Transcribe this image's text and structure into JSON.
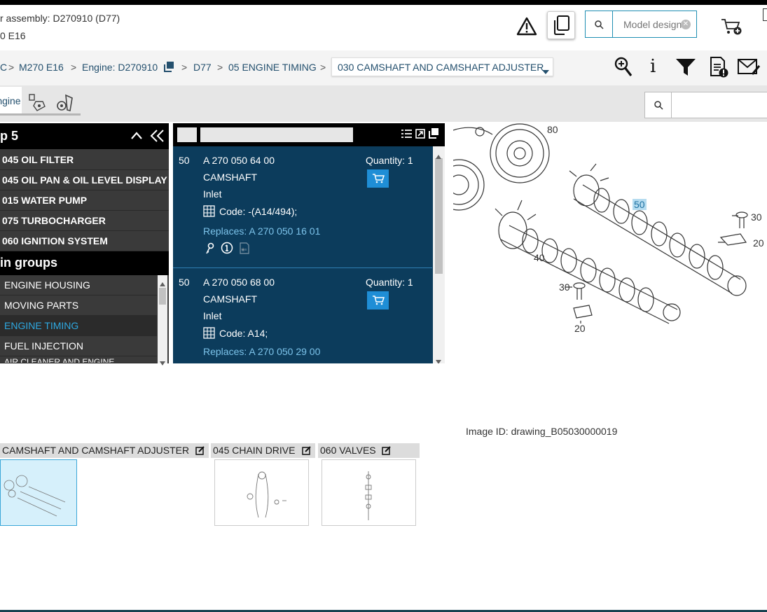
{
  "header": {
    "line1": "r assembly: D270910 (D77)",
    "line2": "0 E16",
    "search_placeholder": "Model design"
  },
  "breadcrumb": {
    "items": [
      "C",
      "M270 E16",
      "Engine: D270910",
      "D77",
      "05 ENGINE TIMING"
    ],
    "dropdown": "030 CAMSHAFT AND CAMSHAFT ADJUSTER",
    "separator": ">"
  },
  "tabs": {
    "engine_label": "Engine"
  },
  "left_panel": {
    "head1": "p 5",
    "subgroups": [
      "045 OIL FILTER",
      "045 OIL PAN & OIL LEVEL DISPLAY",
      "015 WATER PUMP",
      "075 TURBOCHARGER",
      "060 IGNITION SYSTEM"
    ],
    "head2": "in groups",
    "groups": [
      "ENGINE HOUSING",
      "MOVING PARTS",
      "ENGINE TIMING",
      "FUEL INJECTION",
      "AIR CLEANER AND ENGINE"
    ]
  },
  "parts": [
    {
      "pos": "50",
      "number": "A 270 050 64 00",
      "name": "CAMSHAFT",
      "desc": "Inlet",
      "code": "Code: -(A14/494);",
      "replaces": "Replaces: A 270 050 16 01",
      "quantity": "Quantity: 1"
    },
    {
      "pos": "50",
      "number": "A 270 050 68 00",
      "name": "CAMSHAFT",
      "desc": "Inlet",
      "code": "Code: A14;",
      "replaces": "Replaces: A 270 050 29 00",
      "quantity": "Quantity: 1"
    }
  ],
  "drawing": {
    "callouts": [
      "80",
      "50",
      "30",
      "20",
      "40",
      "30",
      "20"
    ],
    "image_id": "Image ID: drawing_B05030000019"
  },
  "thumbnails": [
    {
      "label": "CAMSHAFT AND CAMSHAFT ADJUSTER"
    },
    {
      "label": "045 CHAIN DRIVE"
    },
    {
      "label": "060 VALVES"
    }
  ],
  "colors": {
    "accent": "#1f8ed6",
    "nav_dark": "#3a3a3a",
    "parts_bg": "#0c3c5c",
    "active_group": "#2ea8e0"
  }
}
